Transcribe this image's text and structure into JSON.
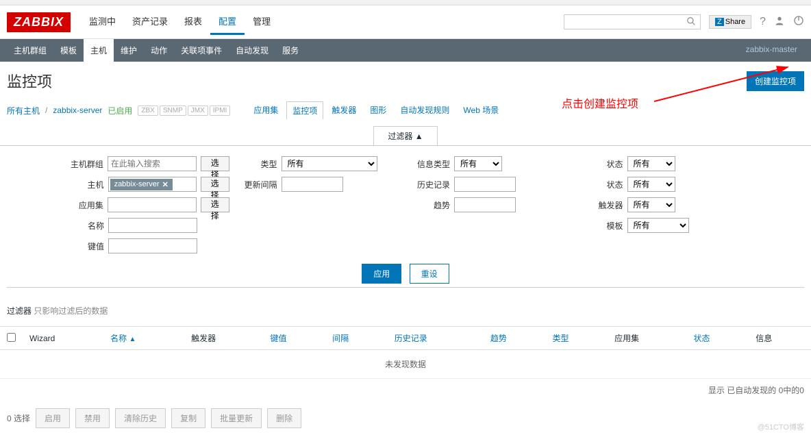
{
  "logo": "ZABBIX",
  "topMenu": [
    "监测中",
    "资产记录",
    "报表",
    "配置",
    "管理"
  ],
  "topMenuActive": 3,
  "share": "Share",
  "subnav": [
    "主机群组",
    "模板",
    "主机",
    "维护",
    "动作",
    "关联项事件",
    "自动发现",
    "服务"
  ],
  "subnavActive": 2,
  "subnavRight": "zabbix-master",
  "pageTitle": "监控项",
  "createBtn": "创建监控项",
  "breadcrumb": {
    "allHosts": "所有主机",
    "host": "zabbix-server",
    "enabled": "已启用",
    "protos": [
      "ZBX",
      "SNMP",
      "JMX",
      "IPMI"
    ]
  },
  "ctxTabs": [
    "应用集",
    "监控项",
    "触发器",
    "图形",
    "自动发现规则",
    "Web 场景"
  ],
  "ctxTabActive": 1,
  "filterToggle": "过滤器 ▲",
  "filters": {
    "hostGroup": {
      "label": "主机群组",
      "placeholder": "在此输入搜索",
      "btn": "选择"
    },
    "host": {
      "label": "主机",
      "value": "zabbix-server",
      "btn": "选择"
    },
    "appSet": {
      "label": "应用集",
      "btn": "选择"
    },
    "name": {
      "label": "名称"
    },
    "key": {
      "label": "键值"
    },
    "type": {
      "label": "类型",
      "value": "所有"
    },
    "interval": {
      "label": "更新间隔"
    },
    "infoType": {
      "label": "信息类型",
      "value": "所有"
    },
    "history": {
      "label": "历史记录"
    },
    "trend": {
      "label": "趋势"
    },
    "state1": {
      "label": "状态",
      "value": "所有"
    },
    "state2": {
      "label": "状态",
      "value": "所有"
    },
    "trigger": {
      "label": "触发器",
      "value": "所有"
    },
    "template": {
      "label": "模板",
      "value": "所有"
    }
  },
  "apply": "应用",
  "reset": "重设",
  "filterNote": {
    "label": "过滤器",
    "warn": "只影响过滤后的数据"
  },
  "columns": {
    "wizard": "Wizard",
    "name": "名称",
    "nameSort": "▲",
    "triggers": "触发器",
    "key": "键值",
    "interval": "间隔",
    "history": "历史记录",
    "trend": "趋势",
    "type": "类型",
    "appSet": "应用集",
    "state": "状态",
    "info": "信息"
  },
  "noData": "未发现数据",
  "tableFooter": "显示 已自动发现的 0中的0",
  "actionBar": {
    "count": "0 选择",
    "enable": "启用",
    "disable": "禁用",
    "clearHistory": "清除历史",
    "copy": "复制",
    "massUpdate": "批量更新",
    "delete": "删除"
  },
  "annotation": "点击创建监控项",
  "watermark": "@51CTO博客"
}
